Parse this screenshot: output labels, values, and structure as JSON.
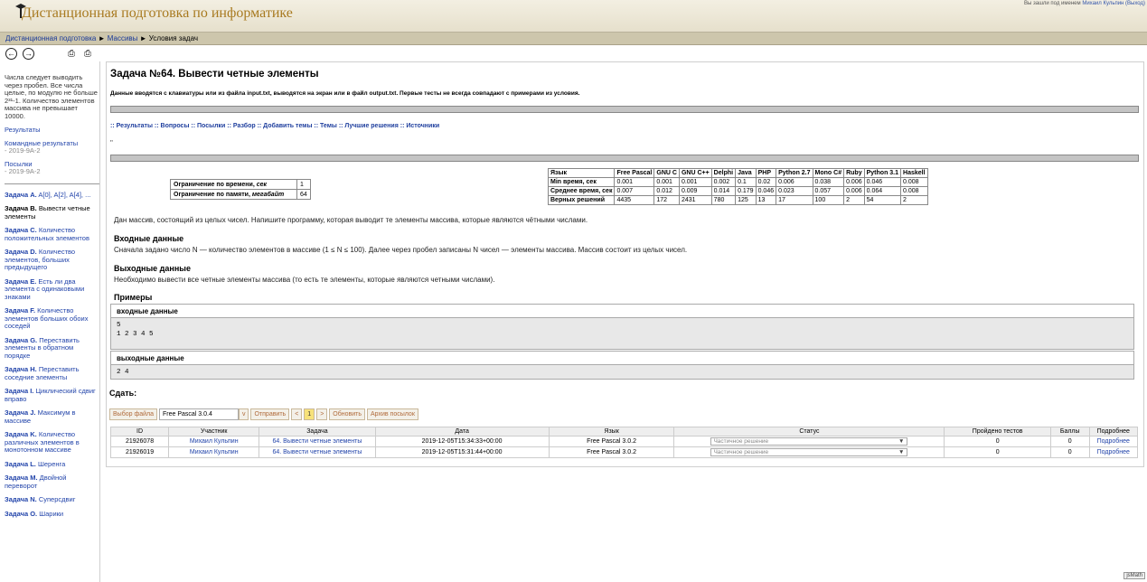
{
  "header": {
    "title": "Дистанционная подготовка по информатике",
    "login_text": "Вы зашли под именем",
    "login_user": "Михаил Кульпин",
    "logout": "(Выход)"
  },
  "breadcrumb": {
    "root": "Дистанционная подготовка",
    "sep": " ► ",
    "section": "Массивы",
    "current": "Условия задач"
  },
  "sidebar": {
    "note": "Числа следует выводить через пробел. Все числа целые, по модулю не больше 2³¹-1. Количество элементов массива не превышает 10000.",
    "results": "Результаты",
    "team_results": "Командные результаты",
    "team_results_sub": "- 2019-9А-2",
    "submissions": "Посылки",
    "submissions_sub": "- 2019-9А-2",
    "tasks": [
      {
        "letter": "Задача A.",
        "name": "A[0], A[2], A[4], ..."
      },
      {
        "letter": "Задача B.",
        "name": "Вывести четные элементы"
      },
      {
        "letter": "Задача C.",
        "name": "Количество положительных элементов"
      },
      {
        "letter": "Задача D.",
        "name": "Количество элементов, больших предыдущего"
      },
      {
        "letter": "Задача E.",
        "name": "Есть ли два элемента с одинаковыми знаками"
      },
      {
        "letter": "Задача F.",
        "name": "Количество элементов больших обоих соседей"
      },
      {
        "letter": "Задача G.",
        "name": "Переставить элементы в обратном порядке"
      },
      {
        "letter": "Задача H.",
        "name": "Переставить соседние элементы"
      },
      {
        "letter": "Задача I.",
        "name": "Циклический сдвиг вправо"
      },
      {
        "letter": "Задача J.",
        "name": "Максимум в массиве"
      },
      {
        "letter": "Задача K.",
        "name": "Количество различных элементов в монотонном массиве"
      },
      {
        "letter": "Задача L.",
        "name": "Шеренга"
      },
      {
        "letter": "Задача M.",
        "name": "Двойной переворот"
      },
      {
        "letter": "Задача N.",
        "name": "Суперсдвиг"
      },
      {
        "letter": "Задача O.",
        "name": "Шарики"
      }
    ]
  },
  "task": {
    "title": "Задача №64. Вывести четные элементы",
    "io_note": "Данные вводятся с клавиатуры или из файла input.txt, выводятся на экран или в файл output.txt. Первые тесты не всегда совпадают с примерами из условия.",
    "tabs": [
      ":: Результаты",
      ":: Вопросы",
      ":: Посылки",
      ":: Разбор",
      ":: Добавить темы",
      ":: Темы",
      ":: Лучшие решения",
      ":: Источники"
    ],
    "dq": "\"",
    "limits": [
      {
        "label": "Ограничение по времени,",
        "unit": "сек",
        "value": "1"
      },
      {
        "label": "Ограничение по памяти,",
        "unit": "мегабайт",
        "value": "64"
      }
    ],
    "stats": {
      "headers": [
        "Язык",
        "Free Pascal",
        "GNU C",
        "GNU C++",
        "Delphi",
        "Java",
        "PHP",
        "Python 2.7",
        "Mono C#",
        "Ruby",
        "Python 3.1",
        "Haskell"
      ],
      "rows": [
        [
          "Min время, сек",
          "0.001",
          "0.001",
          "0.001",
          "0.002",
          "0.1",
          "0.02",
          "0.006",
          "0.038",
          "0.006",
          "0.046",
          "0.008"
        ],
        [
          "Среднее время, сек",
          "0.007",
          "0.012",
          "0.009",
          "0.014",
          "0.179",
          "0.046",
          "0.023",
          "0.057",
          "0.006",
          "0.064",
          "0.008"
        ],
        [
          "Верных решений",
          "4435",
          "172",
          "2431",
          "780",
          "125",
          "13",
          "17",
          "100",
          "2",
          "54",
          "2"
        ]
      ]
    },
    "statement": "Дан массив, состоящий из целых чисел. Напишите программу, которая выводит те элементы массива, которые являются чётными числами.",
    "input_h": "Входные данные",
    "input_text": "Сначала задано число N — количество элементов в массиве (1 ≤ N ≤ 100). Далее через пробел записаны N чисел — элементы массива. Массив состоит из целых чисел.",
    "output_h": "Выходные данные",
    "output_text": "Необходимо вывести все четные элементы массива (то есть те элементы, которые являются четными числами).",
    "examples_h": "Примеры",
    "ex_in_h": "входные данные",
    "ex_in": "5\n1 2 3 4 5",
    "ex_out_h": "выходные данные",
    "ex_out": "2 4"
  },
  "submit": {
    "label": "Сдать:",
    "file_btn": "Выбор файла",
    "compiler": "Free Pascal 3.0.4",
    "arrow": "v",
    "send": "Отправить",
    "prev": "<",
    "page": "1",
    "next": ">",
    "refresh": "Обновить",
    "archive": "Архив посылок"
  },
  "submissions": {
    "headers": [
      "ID",
      "Участник",
      "Задача",
      "Дата",
      "Язык",
      "Статус",
      "Пройдено тестов",
      "Баллы",
      "Подробнее"
    ],
    "rows": [
      {
        "id": "21926078",
        "user": "Михаил Кульпин",
        "task": "64. Вывести четные элементы",
        "date": "2019-12-05T15:34:33+00:00",
        "lang": "Free Pascal 3.0.2",
        "status": "Частичное решение",
        "tests": "0",
        "score": "0",
        "more": "Подробнее"
      },
      {
        "id": "21926019",
        "user": "Михаил Кульпин",
        "task": "64. Вывести четные элементы",
        "date": "2019-12-05T15:31:44+00:00",
        "lang": "Free Pascal 3.0.2",
        "status": "Частичное решение",
        "tests": "0",
        "score": "0",
        "more": "Подробнее"
      }
    ]
  },
  "footer": {
    "jsmath": "jsMath"
  }
}
